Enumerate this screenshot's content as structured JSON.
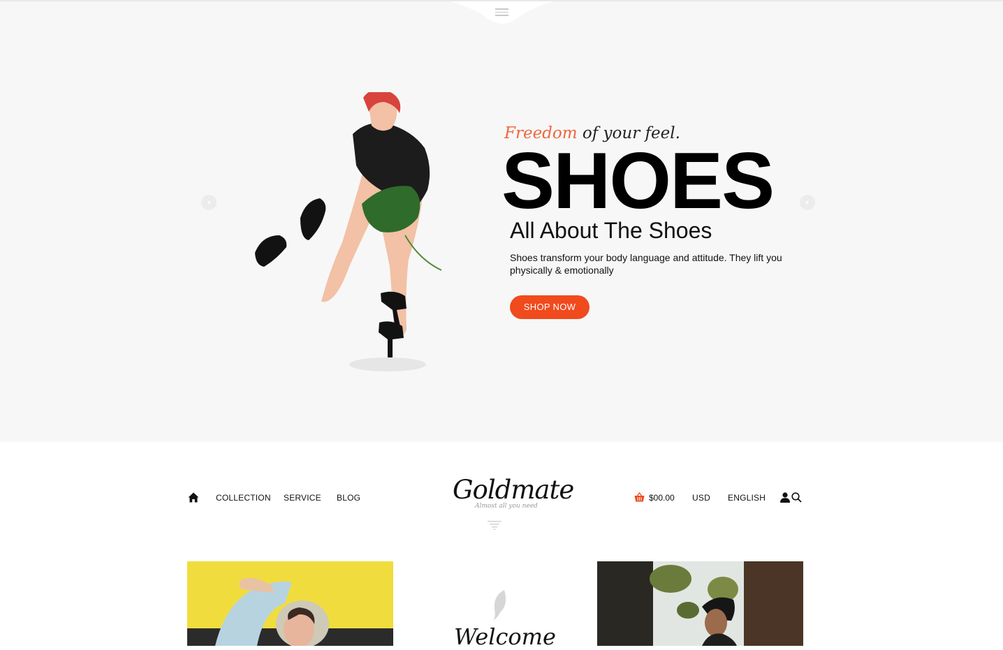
{
  "hero": {
    "tagline_accent": "Freedom",
    "tagline_rest": "of your feel.",
    "title": "SHOES",
    "subtitle": "All About The Shoes",
    "description": "Shoes transform your body language and attitude. They lift you physically & emotionally",
    "cta_label": "SHOP NOW",
    "accent_color": "#f0663d",
    "button_color": "#f04a1d"
  },
  "nav": {
    "home_icon": "home-icon",
    "links": [
      "COLLECTION",
      "SERVICE",
      "BLOG"
    ],
    "logo": "Goldmate",
    "logo_tagline": "Almost all you need",
    "cart_total": "$00.00",
    "currency": "USD",
    "language": "ENGLISH",
    "icons": [
      "menu-icon",
      "filter-icon",
      "cart-icon",
      "user-icon",
      "search-icon"
    ]
  },
  "welcome": {
    "title": "Welcome",
    "icon": "feather-icon"
  }
}
